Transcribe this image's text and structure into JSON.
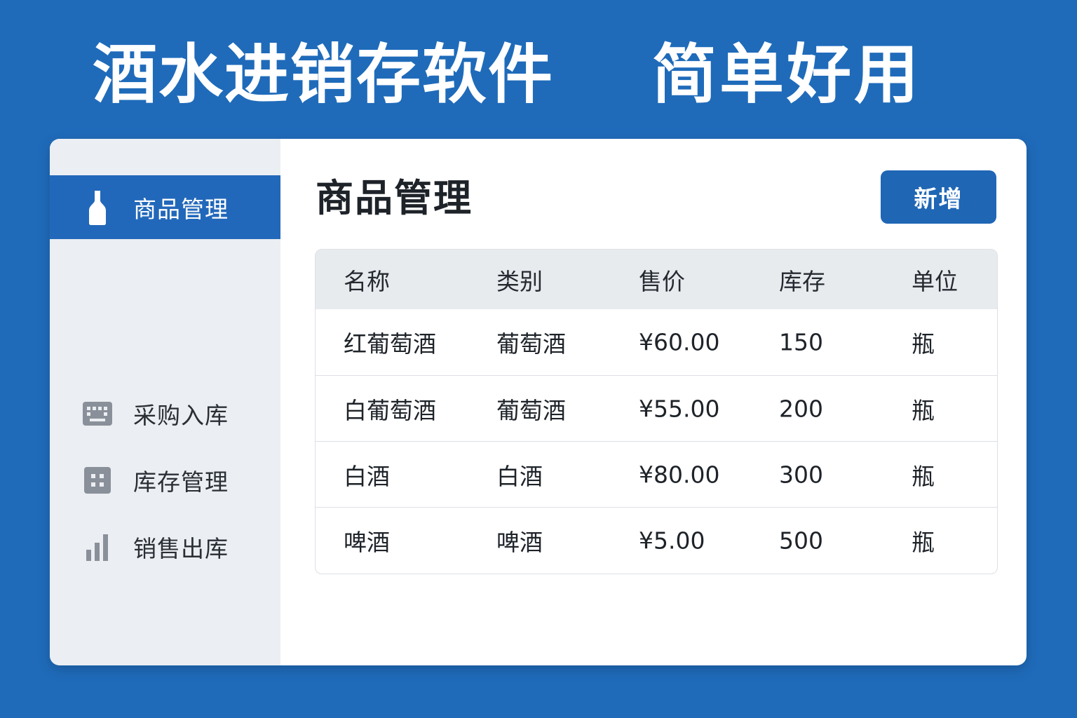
{
  "banner": {
    "title": "酒水进销存软件",
    "slogan": "简单好用"
  },
  "sidebar": {
    "items": [
      {
        "label": "商品管理",
        "icon": "bottle-icon",
        "active": true
      },
      {
        "label": "采购入库",
        "icon": "keyboard-icon",
        "active": false
      },
      {
        "label": "库存管理",
        "icon": "grid-icon",
        "active": false
      },
      {
        "label": "销售出库",
        "icon": "bar-chart-icon",
        "active": false
      }
    ]
  },
  "main": {
    "title": "商品管理",
    "add_label": "新增"
  },
  "table": {
    "headers": [
      "名称",
      "类别",
      "售价",
      "库存",
      "单位"
    ],
    "rows": [
      [
        "红葡萄酒",
        "葡萄酒",
        "¥60.00",
        "150",
        "瓶"
      ],
      [
        "白葡萄酒",
        "葡萄酒",
        "¥55.00",
        "200",
        "瓶"
      ],
      [
        "白酒",
        "白酒",
        "¥80.00",
        "300",
        "瓶"
      ],
      [
        "啤酒",
        "啤酒",
        "¥5.00",
        "500",
        "瓶"
      ]
    ]
  },
  "colors": {
    "background": "#1F6BBA",
    "accent": "#2268BA",
    "sidebar_bg": "#EBEEF2",
    "header_bg": "#E8EBEE"
  }
}
